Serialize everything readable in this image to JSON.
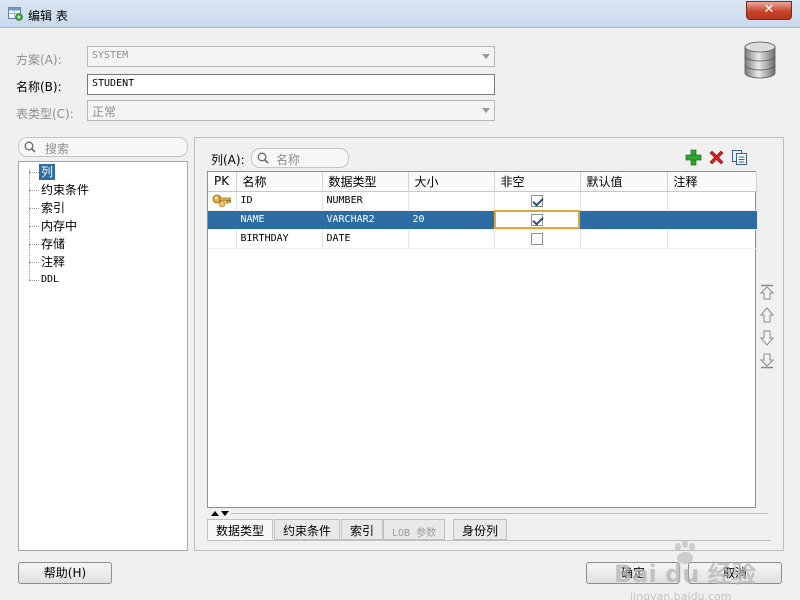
{
  "window": {
    "title": "编辑 表",
    "close_label": "✕"
  },
  "form": {
    "schema_label": "方案(A):",
    "schema_value": "SYSTEM",
    "name_label": "名称(B):",
    "name_value": "STUDENT",
    "type_label": "表类型(C):",
    "type_value": "正常"
  },
  "nav": {
    "search_placeholder": "搜索",
    "items": [
      "列",
      "约束条件",
      "索引",
      "内存中",
      "存储",
      "注释",
      "DDL"
    ],
    "selected_index": 0
  },
  "columns_panel": {
    "label": "列(A):",
    "search_placeholder": "名称",
    "headers": [
      "PK",
      "名称",
      "数据类型",
      "大小",
      "非空",
      "默认值",
      "注释"
    ],
    "rows": [
      {
        "pk": true,
        "name": "ID",
        "type": "NUMBER",
        "size": "",
        "not_null": true,
        "default": "",
        "comment": ""
      },
      {
        "pk": false,
        "name": "NAME",
        "type": "VARCHAR2",
        "size": "20",
        "not_null": true,
        "default": "",
        "comment": ""
      },
      {
        "pk": false,
        "name": "BIRTHDAY",
        "type": "DATE",
        "size": "",
        "not_null": false,
        "default": "",
        "comment": ""
      }
    ],
    "selected_row": 1
  },
  "bottom_tabs": [
    "数据类型",
    "约束条件",
    "索引",
    "LOB 参数",
    "身份列"
  ],
  "buttons": {
    "help": "帮助(H)",
    "ok": "确定",
    "cancel": "取消"
  },
  "watermark": {
    "brand": "Bai du 经验",
    "url": "jingyan.baidu.com"
  },
  "colors": {
    "selection": "#2e6da4",
    "add_icon": "#2fa52f",
    "delete_icon": "#d3221b",
    "focus_outline": "#e0a83c"
  }
}
